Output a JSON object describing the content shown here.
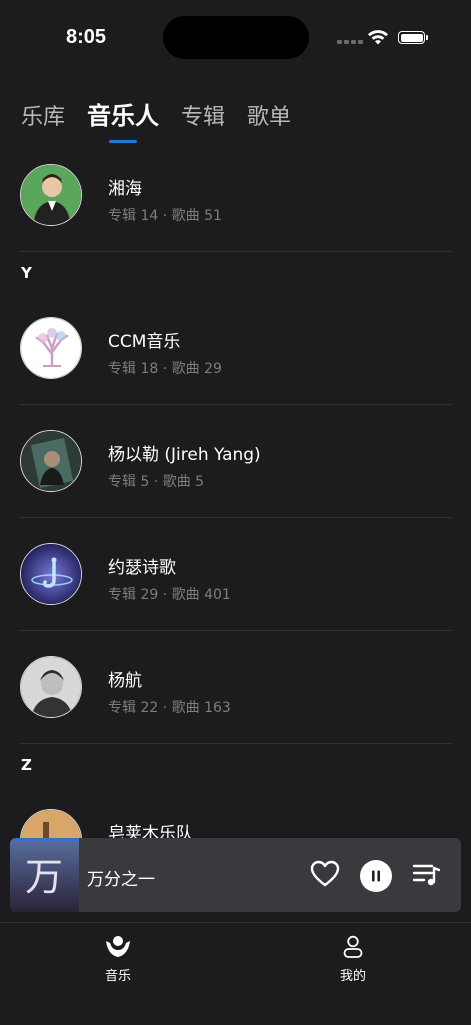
{
  "status_bar": {
    "time": "8:05"
  },
  "tabs": [
    {
      "label": "乐库",
      "active": false
    },
    {
      "label": "音乐人",
      "active": true
    },
    {
      "label": "专辑",
      "active": false
    },
    {
      "label": "歌单",
      "active": false
    }
  ],
  "artists": [
    {
      "name": "湘海",
      "meta": "专辑 14 · 歌曲 51"
    },
    {
      "name": "CCM音乐",
      "meta": "专辑 18 · 歌曲 29"
    },
    {
      "name": "杨以勒 (Jireh Yang)",
      "meta": "专辑 5 · 歌曲 5"
    },
    {
      "name": "约瑟诗歌",
      "meta": "专辑 29 · 歌曲 401"
    },
    {
      "name": "杨航",
      "meta": "专辑 22 · 歌曲 163"
    },
    {
      "name": "皂荚木乐队",
      "meta": ""
    }
  ],
  "sections": {
    "y": "Y",
    "z": "Z"
  },
  "now_playing": {
    "title": "万分之一",
    "cover_text": "万"
  },
  "tabbar": [
    {
      "label": "音乐",
      "icon": "music-person-icon",
      "active": true
    },
    {
      "label": "我的",
      "icon": "profile-icon",
      "active": false
    }
  ],
  "colors": {
    "background": "#1c1c1e",
    "accent": "#1f7ad6",
    "player_bg": "#3a3a3e"
  }
}
